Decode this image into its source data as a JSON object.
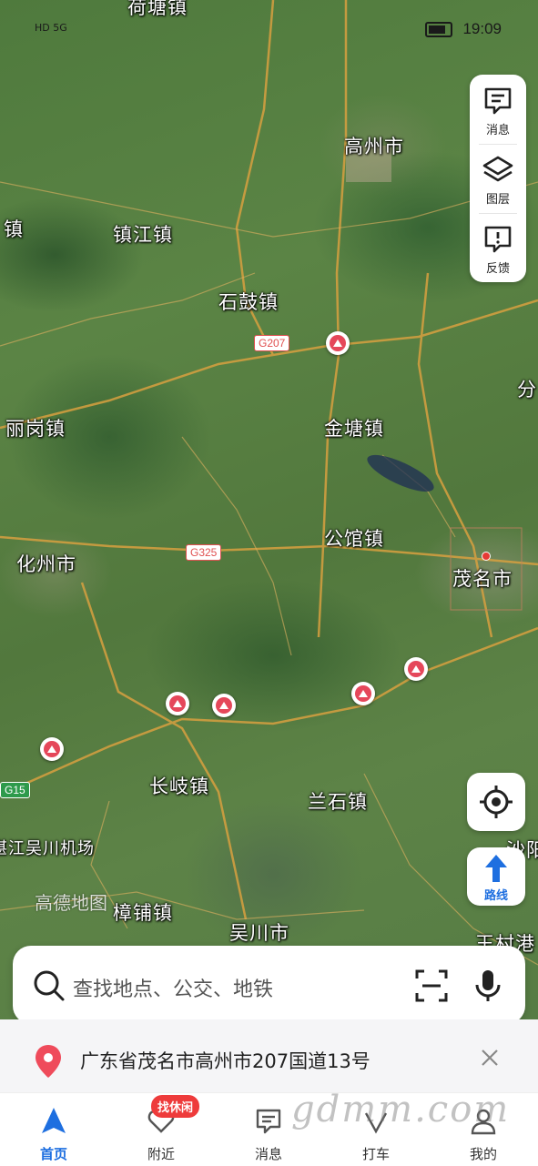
{
  "status_bar": {
    "network": "HD 5G",
    "time": "19:09"
  },
  "map": {
    "places": [
      {
        "id": "hetang",
        "label": "荷塘镇"
      },
      {
        "id": "gaozhou",
        "label": "高州市"
      },
      {
        "id": "zhen_left",
        "label": "镇"
      },
      {
        "id": "zhenjiang",
        "label": "镇江镇"
      },
      {
        "id": "shigu",
        "label": "石鼓镇"
      },
      {
        "id": "fen",
        "label": "分"
      },
      {
        "id": "ligang",
        "label": "丽岗镇"
      },
      {
        "id": "jintang",
        "label": "金塘镇"
      },
      {
        "id": "gongguan",
        "label": "公馆镇"
      },
      {
        "id": "huazhou",
        "label": "化州市"
      },
      {
        "id": "maoming",
        "label": "茂名市"
      },
      {
        "id": "changqi",
        "label": "长岐镇"
      },
      {
        "id": "lanshi",
        "label": "兰石镇"
      },
      {
        "id": "airport",
        "label": "湛江吴川机场"
      },
      {
        "id": "shayang",
        "label": "沙阳"
      },
      {
        "id": "zhangpu",
        "label": "樟铺镇"
      },
      {
        "id": "wuchuan",
        "label": "吴川市"
      },
      {
        "id": "wangcun",
        "label": "王村港"
      }
    ],
    "roads": [
      {
        "id": "g207",
        "label": "G207"
      },
      {
        "id": "g325",
        "label": "G325"
      },
      {
        "id": "g15",
        "label": "G15"
      }
    ],
    "watermark": "高德地图"
  },
  "side_panel": {
    "messages_label": "消息",
    "layers_label": "图层",
    "feedback_label": "反馈"
  },
  "route_button_label": "路线",
  "search": {
    "placeholder": "查找地点、公交、地铁"
  },
  "address": "广东省茂名市高州市207国道13号",
  "tabs": [
    {
      "label": "首页"
    },
    {
      "label": "附近"
    },
    {
      "label": "消息"
    },
    {
      "label": "打车"
    },
    {
      "label": "我的"
    }
  ],
  "nearby_badge": "找休闲",
  "site_watermark": "gdmm.com",
  "colors": {
    "accent": "#1e6fe0",
    "poi": "#e5475a",
    "badge": "#ee3b3b"
  }
}
